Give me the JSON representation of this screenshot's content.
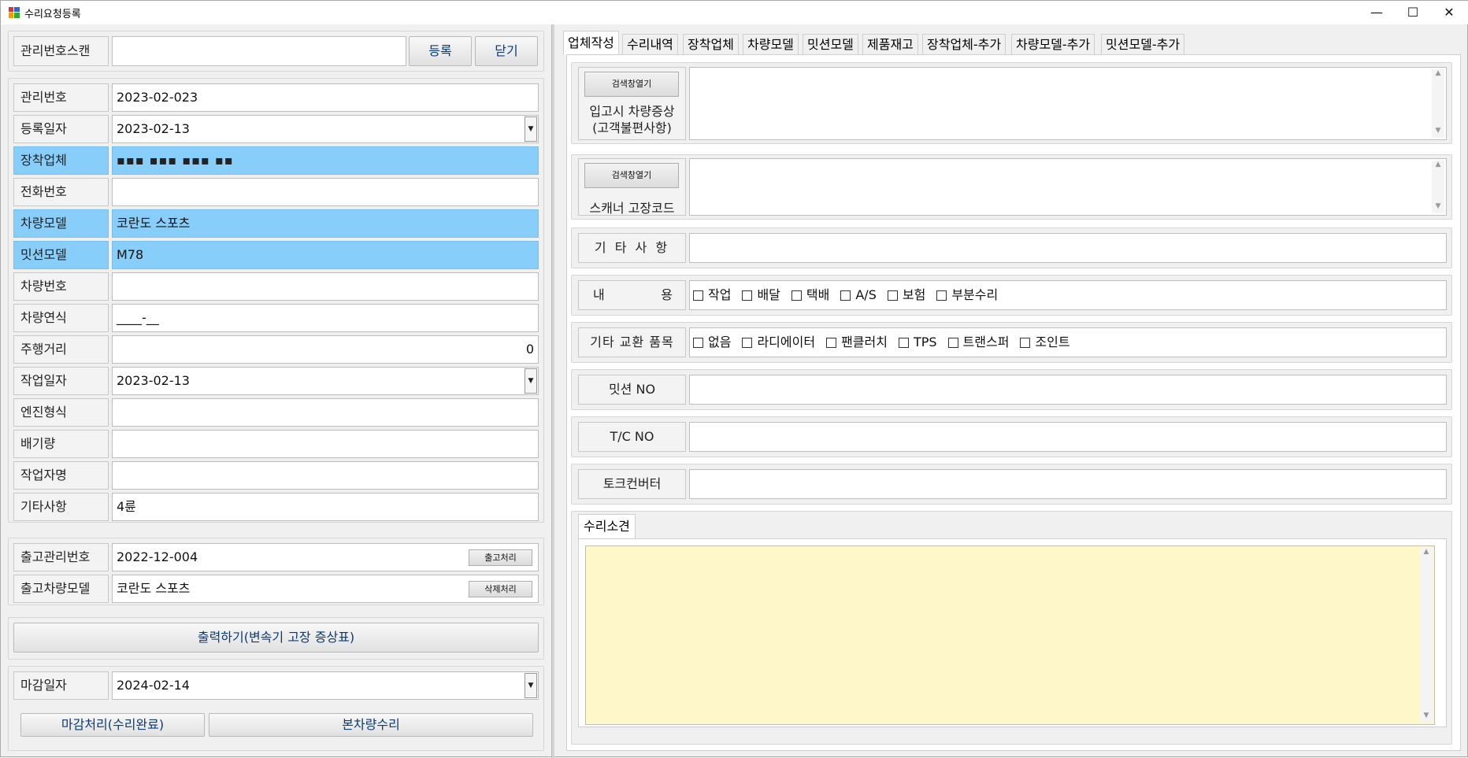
{
  "window": {
    "title": "수리요청등록",
    "minimize": "—",
    "maximize": "☐",
    "close": "✕"
  },
  "scan": {
    "label": "관리번호스캔",
    "value": "",
    "register_button": "등록",
    "close_button": "닫기"
  },
  "form": {
    "mgmt_no_label": "관리번호",
    "mgmt_no": "2023-02-023",
    "reg_date_label": "등록일자",
    "reg_date": "2023-02-13",
    "installer_label": "장착업체",
    "installer": "▪▪▪  ▪▪▪ ▪▪▪ ▪▪",
    "phone_label": "전화번호",
    "phone": "",
    "car_model_label": "차량모델",
    "car_model": "코란도 스포츠",
    "mission_model_label": "밋션모델",
    "mission_model": "M78",
    "car_no_label": "차량번호",
    "car_no": "",
    "car_year_label": "차량연식",
    "car_year": "____-__",
    "mileage_label": "주행거리",
    "mileage": "0",
    "work_date_label": "작업일자",
    "work_date": "2023-02-13",
    "engine_label": "엔진형식",
    "engine": "",
    "displacement_label": "배기량",
    "displacement": "",
    "worker_label": "작업자명",
    "worker": "",
    "etc_label": "기타사항",
    "etc": "4륜"
  },
  "release": {
    "release_no_label": "출고관리번호",
    "release_no": "2022-12-004",
    "release_button": "출고처리",
    "release_model_label": "출고차량모델",
    "release_model": "코란도 스포츠",
    "delete_button": "삭제처리"
  },
  "print_button": "출력하기(변속기 고장 증상표)",
  "deadline": {
    "label": "마감일자",
    "value": "2024-02-14",
    "close_button": "마감처리(수리완료)",
    "own_repair_button": "본차량수리"
  },
  "tabs": [
    "업체작성",
    "수리내역",
    "장착업체",
    "차량모델",
    "밋션모델",
    "제품재고",
    "장착업체-추가",
    "차량모델-추가",
    "밋션모델-추가"
  ],
  "right": {
    "search_button": "검색창열기",
    "symptom_label_1": "입고시 차량증상",
    "symptom_label_2": "(고객불편사항)",
    "symptom_value": "",
    "search_button_2": "검색창열기",
    "scanner_label": "스캐너 고장코드",
    "scanner_value": "",
    "etc_label": "기 타 사 항",
    "etc_value": "",
    "content_label_a": "내",
    "content_label_b": "용",
    "content_options": [
      "작업",
      "배달",
      "택배",
      "A/S",
      "보험",
      "부분수리"
    ],
    "exchange_label": "기타 교환 품목",
    "exchange_options": [
      "없음",
      "라디에이터",
      "팬클러치",
      "TPS",
      "트랜스퍼",
      "조인트"
    ],
    "mission_no_label": "밋션 NO",
    "mission_no": "",
    "tc_no_label": "T/C NO",
    "tc_no": "",
    "torque_label": "토크컨버터",
    "torque": "",
    "opinion_tab": "수리소견",
    "opinion_value": ""
  }
}
